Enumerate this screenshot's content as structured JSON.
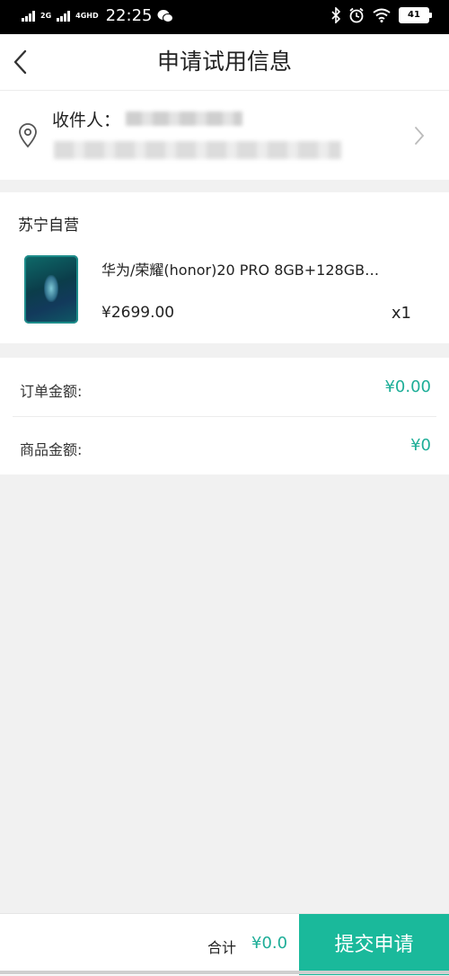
{
  "status_bar": {
    "network_1": "2G",
    "network_2": "4GHD",
    "time": "22:25",
    "battery": "41"
  },
  "nav": {
    "title": "申请试用信息"
  },
  "address": {
    "recipient_label": "收件人："
  },
  "goods": {
    "store_name": "苏宁自营",
    "name": "华为/荣耀(honor)20 PRO 8GB+128GB…",
    "price": "¥2699.00",
    "quantity": "x1"
  },
  "amounts": {
    "order_label": "订单金额:",
    "order_value": "¥0.00",
    "goods_label": "商品金额:",
    "goods_value": "¥0"
  },
  "footer": {
    "total_label": "合计",
    "total_value": "¥0.0",
    "submit_label": "提交申请"
  },
  "colors": {
    "accent": "#1eae98",
    "submit_bg": "#1ab99b"
  }
}
